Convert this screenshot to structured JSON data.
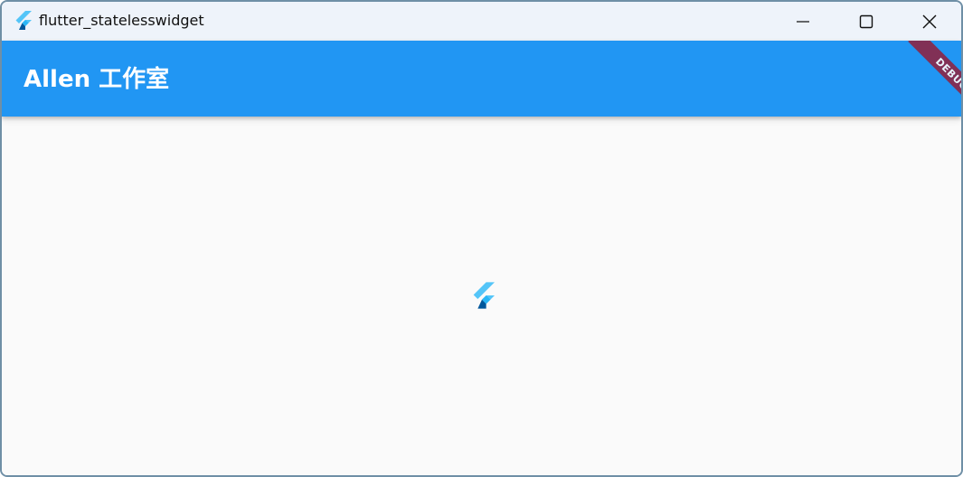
{
  "window": {
    "title": "flutter_statelesswidget",
    "icon": "flutter-logo-icon",
    "controls": {
      "minimize": "minimize-icon",
      "maximize": "maximize-icon",
      "close": "close-icon"
    }
  },
  "appbar": {
    "title": "Allen 工作室",
    "color": "#2196f3"
  },
  "debug_banner": {
    "label": "DEBUG",
    "color": "#8c2545"
  },
  "body": {
    "center_icon": "flutter-logo-icon",
    "background": "#fafafa"
  }
}
